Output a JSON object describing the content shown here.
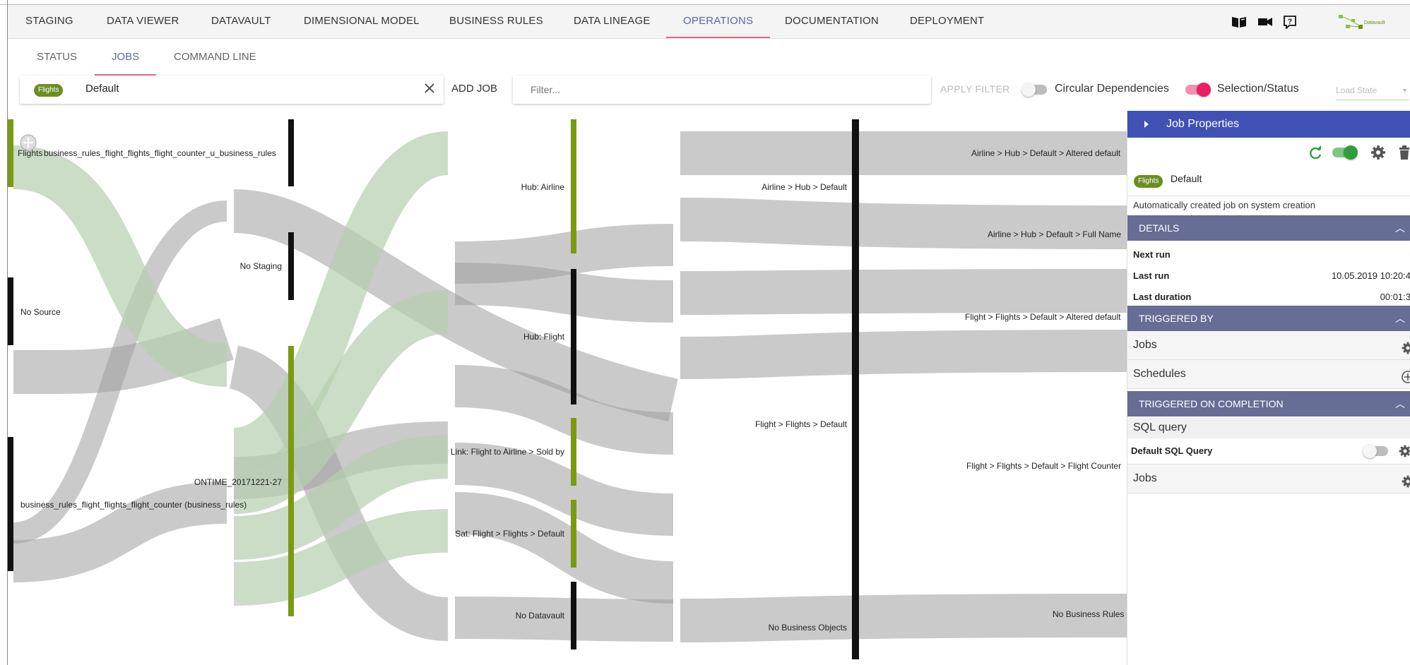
{
  "top_nav": {
    "tabs": [
      {
        "label": "STAGING"
      },
      {
        "label": "DATA VIEWER"
      },
      {
        "label": "DATAVAULT"
      },
      {
        "label": "DIMENSIONAL MODEL"
      },
      {
        "label": "BUSINESS RULES"
      },
      {
        "label": "DATA LINEAGE"
      },
      {
        "label": "OPERATIONS",
        "active": true
      },
      {
        "label": "DOCUMENTATION"
      },
      {
        "label": "DEPLOYMENT"
      }
    ],
    "icons": [
      "book-open-icon",
      "video-camera-icon",
      "help-question-icon"
    ],
    "logo_text": "Datavault"
  },
  "sub_tabs": [
    {
      "label": "STATUS"
    },
    {
      "label": "JOBS",
      "active": true
    },
    {
      "label": "COMMAND LINE"
    }
  ],
  "filter_bar": {
    "job_chip": "Flights",
    "job_name": "Default",
    "add_job_label": "ADD JOB",
    "filter_placeholder": "Filter...",
    "apply_filter_label": "APPLY FILTER",
    "circular_dependencies_label": "Circular Dependencies",
    "circular_dependencies_on": false,
    "selection_status_label": "Selection/Status",
    "selection_status_on": true,
    "load_state_placeholder": "Load State"
  },
  "sankey": {
    "nodes": [
      {
        "label": "Flights",
        "column": 0
      },
      {
        "label": "No Source",
        "column": 0
      },
      {
        "label": "business_rules_flight_flights_flight_counter (business_rules)",
        "column": 0
      },
      {
        "label": "business_rules_flight_flights_flight_counter_u_business_rules",
        "column": 1
      },
      {
        "label": "No Staging",
        "column": 1
      },
      {
        "label": "ONTIME_20171221-27",
        "column": 1
      },
      {
        "label": "Hub: Airline",
        "column": 2
      },
      {
        "label": "Hub: Flight",
        "column": 2
      },
      {
        "label": "Link: Flight to Airline > Sold by",
        "column": 2
      },
      {
        "label": "Sat: Flight > Flights > Default",
        "column": 2
      },
      {
        "label": "No Datavault",
        "column": 2
      },
      {
        "label": "Airline > Hub > Default",
        "column": 3
      },
      {
        "label": "Flight > Flights > Default",
        "column": 3
      },
      {
        "label": "No Business Objects",
        "column": 3
      },
      {
        "label": "Airline > Hub > Default > Altered default",
        "column": 4
      },
      {
        "label": "Airline > Hub > Default > Full Name",
        "column": 4
      },
      {
        "label": "Flight > Flights > Default > Altered default",
        "column": 4
      },
      {
        "label": "Flight > Flights > Default > Flight Counter",
        "column": 4
      },
      {
        "label": "No Business Rules",
        "column": 4
      }
    ]
  },
  "job_properties": {
    "title": "Job Properties",
    "enabled": true,
    "chip": "Flights",
    "job_name": "Default",
    "description": "Automatically created job on system creation",
    "details_title": "DETAILS",
    "next_run_label": "Next run",
    "next_run_value": "",
    "last_run_label": "Last run",
    "last_run_value": "10.05.2019 10:20:4",
    "last_duration_label": "Last duration",
    "last_duration_value": "00:01:3",
    "triggered_by_title": "TRIGGERED BY",
    "triggered_by_items": [
      {
        "label": "Jobs",
        "icon": "gear-icon"
      },
      {
        "label": "Schedules",
        "icon": "add-circle-icon"
      }
    ],
    "triggered_on_completion_title": "TRIGGERED ON COMPLETION",
    "sql_query_label": "SQL query",
    "default_sql_query_label": "Default SQL Query",
    "default_sql_query_on": false,
    "completion_jobs_label": "Jobs"
  }
}
